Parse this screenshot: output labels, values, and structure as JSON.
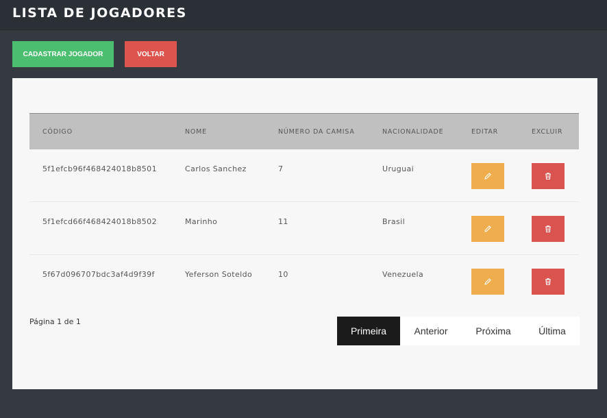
{
  "header": {
    "title": "LISTA DE JOGADORES"
  },
  "toolbar": {
    "cadastrar_label": "CADASTRAR JOGADOR",
    "voltar_label": "VOLTAR"
  },
  "table": {
    "columns": [
      "CÓDIGO",
      "NOME",
      "NÚMERO DA CAMISA",
      "NACIONALIDADE",
      "EDITAR",
      "EXCLUIR"
    ],
    "rows": [
      {
        "codigo": "5f1efcb96f468424018b8501",
        "nome": "Carlos Sanchez",
        "numero": "7",
        "nacionalidade": "Uruguai"
      },
      {
        "codigo": "5f1efcd66f468424018b8502",
        "nome": "Marinho",
        "numero": "11",
        "nacionalidade": "Brasil"
      },
      {
        "codigo": "5f67d096707bdc3af4d9f39f",
        "nome": "Yeferson Soteldo",
        "numero": "10",
        "nacionalidade": "Venezuela"
      }
    ]
  },
  "pagination": {
    "info": "Página 1 de 1",
    "first": "Primeira",
    "prev": "Anterior",
    "next": "Próxima",
    "last": "Última"
  },
  "icons": {
    "edit": "pencil-icon",
    "delete": "trash-icon"
  },
  "colors": {
    "background": "#343a40",
    "header": "#2b3036",
    "cadastrar": "#4cbe70",
    "voltar": "#dc544d",
    "edit": "#f0ad4e",
    "delete": "#d9534f",
    "table_header": "#c0c0c0"
  }
}
